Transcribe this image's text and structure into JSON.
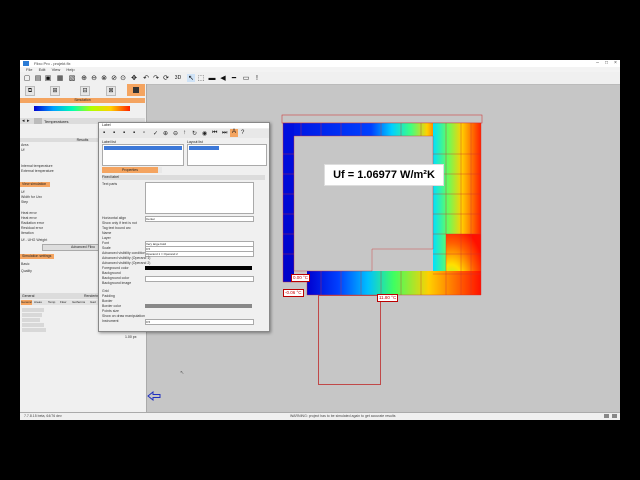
{
  "window": {
    "title": "Flixo Pro - projekt.flx"
  },
  "menu": [
    "File",
    "Edit",
    "View",
    "Help"
  ],
  "left": {
    "simulation_label": "Simulation",
    "temperatures_tab": "Temperatures",
    "results_header": "Results",
    "result_rows": [
      "Area",
      "Uf",
      "",
      "Internal temperature",
      "External temperature",
      "",
      "",
      ""
    ],
    "view_simulation": "View simulation",
    "view_rows": [
      "Uf",
      "Width for Uxx",
      "Step",
      "",
      "Heat error",
      "Heat error",
      "Radiation error",
      "Residual error",
      "Iteration"
    ],
    "thermal_weight": "Uf - UHG Weight",
    "advanced_btn": "Advanced Flixo",
    "simulation_settings": "Simulation settings",
    "basic_label": "Basic",
    "quality_label": "Quality",
    "tabs2": [
      "General",
      "Areas",
      "Temp",
      "Flow",
      "Isotherms",
      "Gad",
      "Rendering"
    ],
    "rendering_settings": "Rendering settings",
    "px_value": "1.00 px"
  },
  "dialog": {
    "title": "Label",
    "col_left": "Label list",
    "col_right": "Layout list",
    "properties_btn": "Properties",
    "fixed_label": "Fixed label",
    "rows": [
      "Text parts",
      "",
      "",
      "",
      "Horizontal align",
      "Show only if text is not",
      "Tag text bound arc",
      "Name",
      "Layer",
      "Font",
      "Scale",
      "Advanced visibility condition",
      "Advanced visibility (Operand 1)",
      "Advanced visibility (Operand 2)",
      "Foreground color",
      "Background",
      "Background color",
      "Background image",
      "Grid",
      "Padding",
      "Border",
      "Border color",
      "Points size",
      "Show on draw manipulation",
      "Instrument"
    ],
    "align_value": "Center",
    "font_value": "Very large bold",
    "scale_value": "0.5",
    "grid_value": "0.5",
    "operand_value": "Operand 1 = Operand 2"
  },
  "canvas": {
    "uf_text": "Uf = 1.06977 W/m²K",
    "temp_labels": [
      "0.00 °C",
      "-0.06 °C",
      "11.80 °C"
    ]
  },
  "status": {
    "left": "7.7.8.15 beta, 64/76 dev",
    "center": "WARNING: project has to be simulated again to get accurate results"
  },
  "colors": {
    "cold": "#0000e8",
    "hot": "#ff0000",
    "background": "#c6c6c6"
  }
}
